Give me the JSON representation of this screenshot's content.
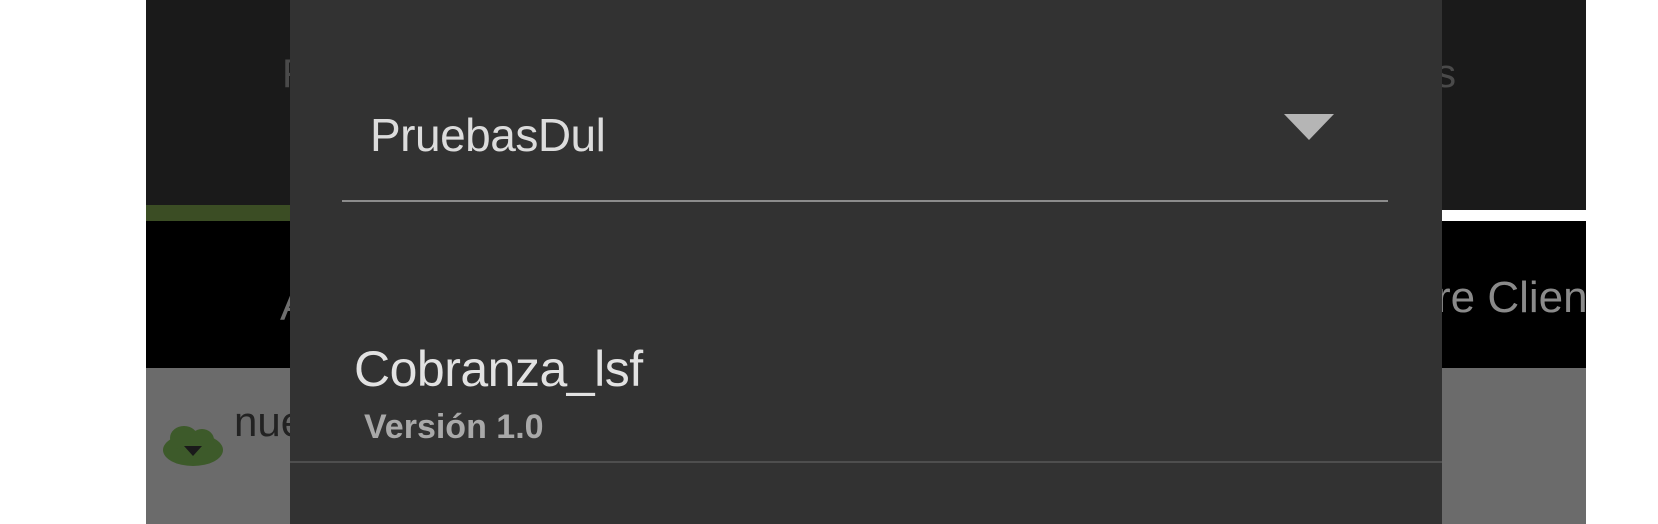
{
  "background_app": {
    "header_left_text": "F",
    "header_right_text": "s",
    "nav_left_text": "A",
    "nav_right_text": "re Clien",
    "content_text": "nue"
  },
  "dialog": {
    "select": {
      "value": "PruebasDul",
      "icon": "dropdown-arrow-icon"
    },
    "items": [
      {
        "title": "Cobranza_lsf",
        "version": "Versión 1.0"
      }
    ]
  },
  "colors": {
    "dialog_bg": "#323232",
    "overlay_header": "#1a1a1a",
    "overlay_nav": "#000000",
    "accent_green": "#3b4d24"
  }
}
